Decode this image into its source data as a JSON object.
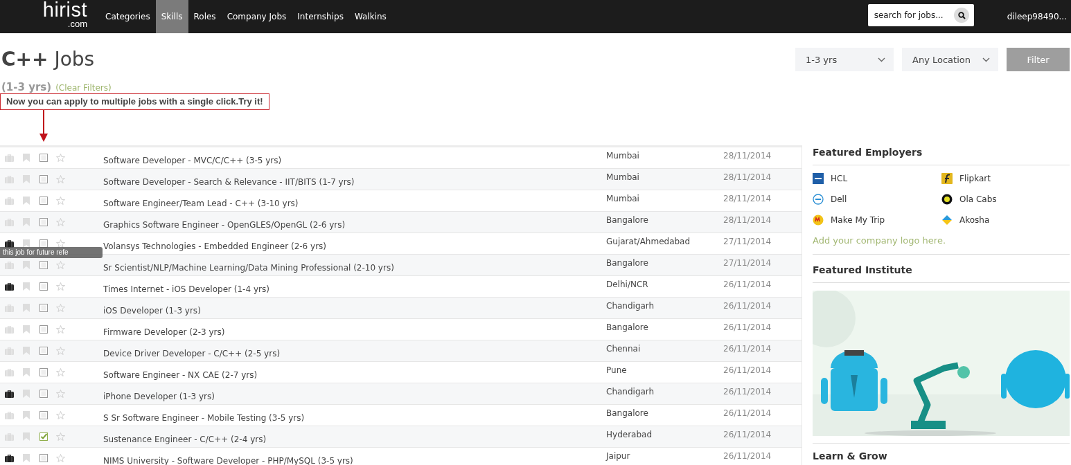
{
  "header": {
    "logo": {
      "name": "hirist",
      "suffix": ".com"
    },
    "nav": [
      {
        "label": "Categories",
        "selected": false
      },
      {
        "label": "Skills",
        "selected": true
      },
      {
        "label": "Roles",
        "selected": false
      },
      {
        "label": "Company Jobs",
        "selected": false
      },
      {
        "label": "Internships",
        "selected": false
      },
      {
        "label": "Walkins",
        "selected": false
      }
    ],
    "search": {
      "placeholder": "search for jobs..."
    },
    "user": "dileep98490..."
  },
  "page": {
    "title": "**C++** Jobs",
    "filters": [
      {
        "value": "1-3 yrs"
      },
      {
        "value": "Any Location"
      }
    ],
    "filter_button": "Filter",
    "active_filter": "(1-3 yrs)",
    "clear_filters": "(Clear Filters)",
    "notice": "Now you can apply to multiple jobs with a single click.Try it!",
    "tooltip": "this job for future refe"
  },
  "jobs": [
    {
      "title": "Software Developer - MVC/C/C++ (3-5 yrs)",
      "location": "Mumbai",
      "date": "28/11/2014",
      "applied": false,
      "checked": false
    },
    {
      "title": "Software Developer - Search & Relevance - IIT/BITS (1-7 yrs)",
      "location": "Mumbai",
      "date": "28/11/2014",
      "applied": false,
      "checked": false
    },
    {
      "title": "Software Engineer/Team Lead - C++ (3-10 yrs)",
      "location": "Mumbai",
      "date": "28/11/2014",
      "applied": false,
      "checked": false
    },
    {
      "title": "Graphics Software Engineer - OpenGLES/OpenGL (2-6 yrs)",
      "location": "Bangalore",
      "date": "28/11/2014",
      "applied": false,
      "checked": false
    },
    {
      "title": "Volansys Technologies - Embedded Engineer (2-6 yrs)",
      "location": "Gujarat/Ahmedabad",
      "date": "27/11/2014",
      "applied": true,
      "checked": false
    },
    {
      "title": "Sr Scientist/NLP/Machine Learning/Data Mining Professional (2-10 yrs)",
      "location": "Bangalore",
      "date": "27/11/2014",
      "applied": false,
      "checked": false
    },
    {
      "title": "Times Internet - iOS Developer (1-4 yrs)",
      "location": "Delhi/NCR",
      "date": "26/11/2014",
      "applied": true,
      "checked": false
    },
    {
      "title": "iOS Developer (1-3 yrs)",
      "location": "Chandigarh",
      "date": "26/11/2014",
      "applied": false,
      "checked": false
    },
    {
      "title": "Firmware Developer (2-3 yrs)",
      "location": "Bangalore",
      "date": "26/11/2014",
      "applied": false,
      "checked": false
    },
    {
      "title": "Device Driver Developer - C/C++ (2-5 yrs)",
      "location": "Chennai",
      "date": "26/11/2014",
      "applied": false,
      "checked": false
    },
    {
      "title": "Software Engineer - NX CAE (2-7 yrs)",
      "location": "Pune",
      "date": "26/11/2014",
      "applied": false,
      "checked": false
    },
    {
      "title": "iPhone Developer (1-3 yrs)",
      "location": "Chandigarh",
      "date": "26/11/2014",
      "applied": true,
      "checked": false
    },
    {
      "title": "S Sr Software Engineer - Mobile Testing (3-5 yrs)",
      "location": "Bangalore",
      "date": "26/11/2014",
      "applied": false,
      "checked": false
    },
    {
      "title": "Sustenance Engineer - C/C++ (2-4 yrs)",
      "location": "Hyderabad",
      "date": "26/11/2014",
      "applied": false,
      "checked": true
    },
    {
      "title": "NIMS University - Software Developer - PHP/MySQL (3-5 yrs)",
      "location": "Jaipur",
      "date": "26/11/2014",
      "applied": true,
      "checked": false
    }
  ],
  "sidebar": {
    "employers_title": "Featured Employers",
    "employers": [
      {
        "name": "HCL"
      },
      {
        "name": "Flipkart"
      },
      {
        "name": "Dell"
      },
      {
        "name": "Ola Cabs"
      },
      {
        "name": "Make My Trip"
      },
      {
        "name": "Akosha"
      }
    ],
    "add_logo": "Add your company logo here.",
    "institute_title": "Featured Institute",
    "learn_title": "Learn & Grow"
  }
}
